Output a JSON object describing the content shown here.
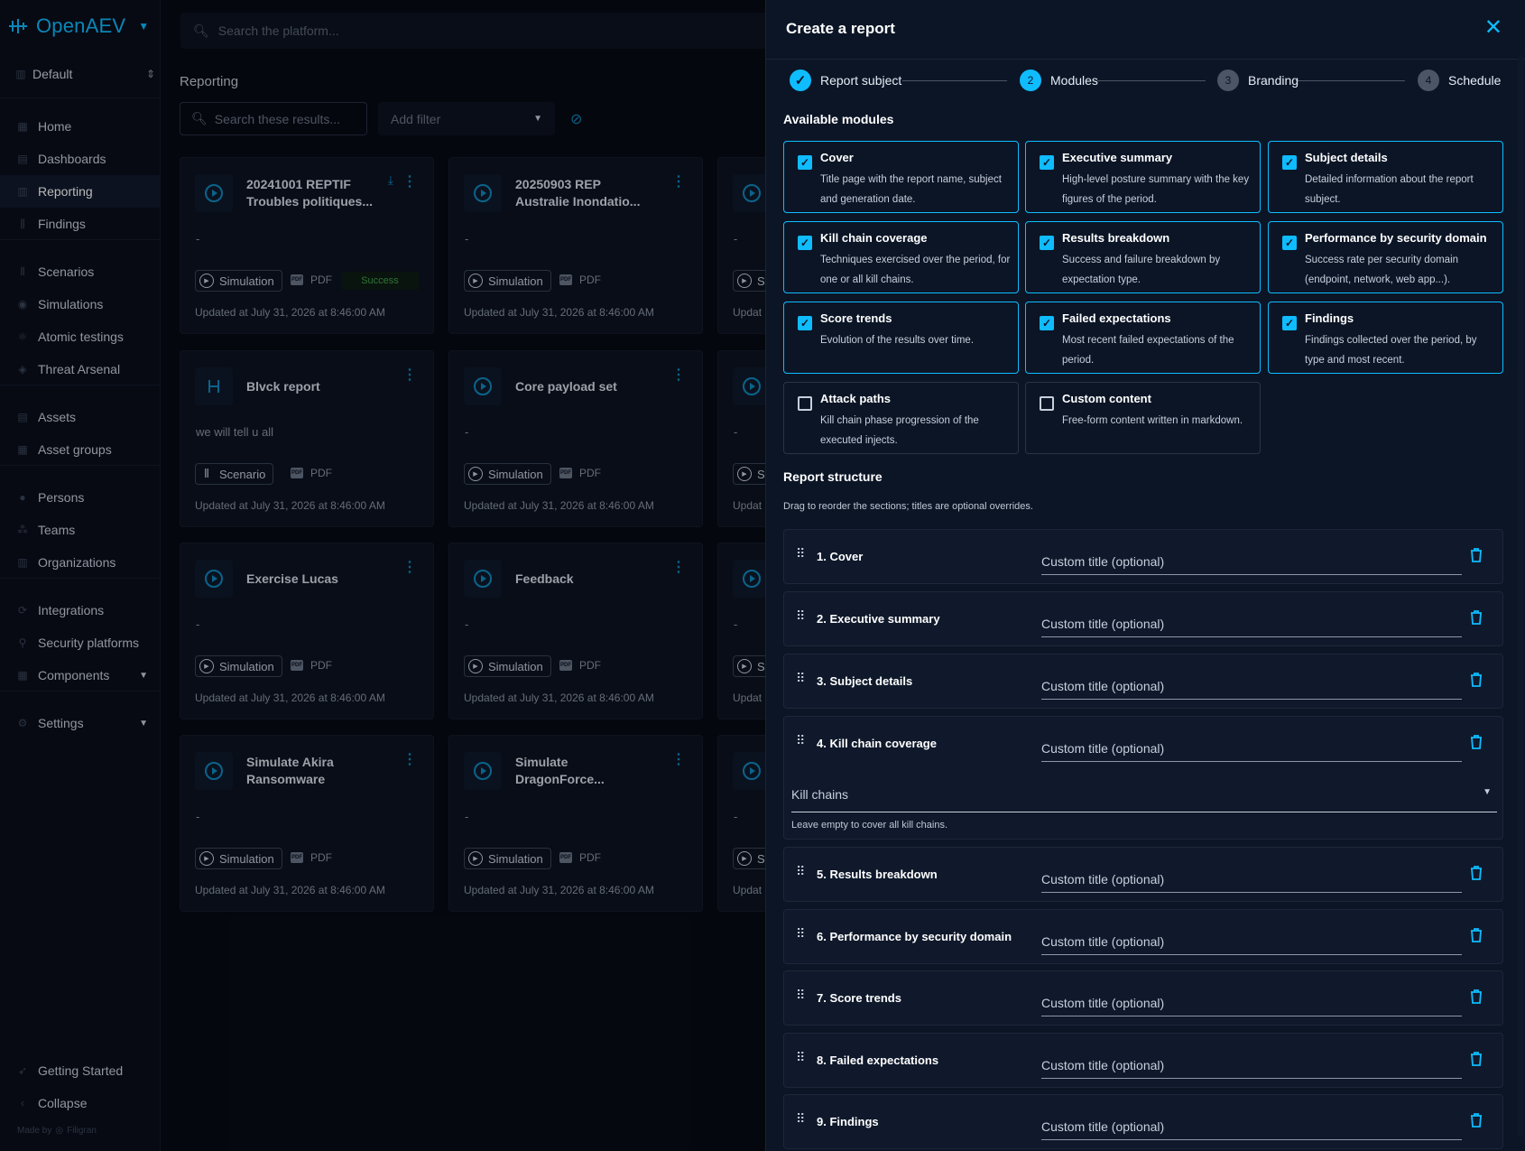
{
  "app": {
    "name": "OpenAEV",
    "workspace": "Default",
    "search_placeholder": "Search the platform...",
    "made_by": "Made by",
    "made_by_brand": "Filigran"
  },
  "sidebar": {
    "items": [
      {
        "label": "Home",
        "icon": "home-icon"
      },
      {
        "label": "Dashboards",
        "icon": "dashboard-icon"
      },
      {
        "label": "Reporting",
        "icon": "reporting-icon",
        "active": true
      },
      {
        "label": "Findings",
        "icon": "findings-icon"
      },
      {
        "label": "Scenarios",
        "icon": "scenario-icon"
      },
      {
        "label": "Simulations",
        "icon": "simulation-icon"
      },
      {
        "label": "Atomic testings",
        "icon": "atomic-icon"
      },
      {
        "label": "Threat Arsenal",
        "icon": "arsenal-icon"
      },
      {
        "label": "Assets",
        "icon": "assets-icon"
      },
      {
        "label": "Asset groups",
        "icon": "asset-groups-icon"
      },
      {
        "label": "Persons",
        "icon": "person-icon"
      },
      {
        "label": "Teams",
        "icon": "teams-icon"
      },
      {
        "label": "Organizations",
        "icon": "organization-icon"
      },
      {
        "label": "Integrations",
        "icon": "integrations-icon"
      },
      {
        "label": "Security platforms",
        "icon": "security-platform-icon"
      },
      {
        "label": "Components",
        "icon": "components-icon"
      },
      {
        "label": "Settings",
        "icon": "settings-icon"
      },
      {
        "label": "Getting Started",
        "icon": "rocket-icon"
      },
      {
        "label": "Collapse",
        "icon": "chevron-left-icon"
      }
    ]
  },
  "main": {
    "title": "Reporting",
    "search_placeholder": "Search these results...",
    "add_filter": "Add filter",
    "cards": [
      {
        "title": "20241001 REPTIF Troubles politiques...",
        "desc": "-",
        "type": "Simulation",
        "format": "PDF",
        "status": "Success",
        "updated": "Updated at July 31, 2026 at 8:46:00 AM"
      },
      {
        "title": "20250903 REP Australie Inondatio...",
        "desc": "-",
        "type": "Simulation",
        "format": "PDF",
        "updated": "Updated at July 31, 2026 at 8:46:00 AM"
      },
      {
        "title": "",
        "desc": "-",
        "type": "Si",
        "format": "",
        "updated": "Updat"
      },
      {
        "title": "Blvck report",
        "desc": "we will tell u all",
        "type": "Scenario",
        "format": "PDF",
        "updated": "Updated at July 31, 2026 at 8:46:00 AM"
      },
      {
        "title": "Core payload set",
        "desc": "-",
        "type": "Simulation",
        "format": "PDF",
        "updated": "Updated at July 31, 2026 at 8:46:00 AM"
      },
      {
        "title": "",
        "desc": "-",
        "type": "Si",
        "format": "",
        "updated": "Updat"
      },
      {
        "title": "Exercise Lucas",
        "desc": "-",
        "type": "Simulation",
        "format": "PDF",
        "updated": "Updated at July 31, 2026 at 8:46:00 AM"
      },
      {
        "title": "Feedback",
        "desc": "-",
        "type": "Simulation",
        "format": "PDF",
        "updated": "Updated at July 31, 2026 at 8:46:00 AM"
      },
      {
        "title": "",
        "desc": "-",
        "type": "Si",
        "format": "",
        "updated": "Updat"
      },
      {
        "title": "Simulate Akira Ransomware",
        "desc": "-",
        "type": "Simulation",
        "format": "PDF",
        "updated": "Updated at July 31, 2026 at 8:46:00 AM"
      },
      {
        "title": "Simulate DragonForce...",
        "desc": "-",
        "type": "Simulation",
        "format": "PDF",
        "updated": "Updated at July 31, 2026 at 8:46:00 AM"
      },
      {
        "title": "",
        "desc": "-",
        "type": "Si",
        "format": "",
        "updated": "Updat"
      }
    ]
  },
  "drawer": {
    "title": "Create a report",
    "steps": [
      {
        "number": "✓",
        "label": "Report subject",
        "state": "done"
      },
      {
        "number": "2",
        "label": "Modules",
        "state": "active"
      },
      {
        "number": "3",
        "label": "Branding",
        "state": "todo"
      },
      {
        "number": "4",
        "label": "Schedule",
        "state": "todo"
      }
    ],
    "available_modules_title": "Available modules",
    "modules": [
      {
        "title": "Cover",
        "desc": "Title page with the report name, subject and generation date.",
        "checked": true
      },
      {
        "title": "Executive summary",
        "desc": "High-level posture summary with the key figures of the period.",
        "checked": true
      },
      {
        "title": "Subject details",
        "desc": "Detailed information about the report subject.",
        "checked": true
      },
      {
        "title": "Kill chain coverage",
        "desc": "Techniques exercised over the period, for one or all kill chains.",
        "checked": true
      },
      {
        "title": "Results breakdown",
        "desc": "Success and failure breakdown by expectation type.",
        "checked": true
      },
      {
        "title": "Performance by security domain",
        "desc": "Success rate per security domain (endpoint, network, web app...).",
        "checked": true
      },
      {
        "title": "Score trends",
        "desc": "Evolution of the results over time.",
        "checked": true
      },
      {
        "title": "Failed expectations",
        "desc": "Most recent failed expectations of the period.",
        "checked": true
      },
      {
        "title": "Findings",
        "desc": "Findings collected over the period, by type and most recent.",
        "checked": true
      },
      {
        "title": "Attack paths",
        "desc": "Kill chain phase progression of the executed injects.",
        "checked": false
      },
      {
        "title": "Custom content",
        "desc": "Free-form content written in markdown.",
        "checked": false
      }
    ],
    "structure_title": "Report structure",
    "structure_subtitle": "Drag to reorder the sections; titles are optional overrides.",
    "custom_title_placeholder": "Custom title (optional)",
    "kill_chains_label": "Kill chains",
    "kill_chains_help": "Leave empty to cover all kill chains.",
    "sections": [
      {
        "label": "1. Cover"
      },
      {
        "label": "2. Executive summary"
      },
      {
        "label": "3. Subject details"
      },
      {
        "label": "4. Kill chain coverage",
        "kill_chains": true
      },
      {
        "label": "5. Results breakdown"
      },
      {
        "label": "6. Performance by security domain"
      },
      {
        "label": "7. Score trends"
      },
      {
        "label": "8. Failed expectations"
      },
      {
        "label": "9. Findings"
      }
    ]
  },
  "colors": {
    "accent": "#0fbcff",
    "background": "#070b14",
    "drawer": "#0b1526",
    "success": "#3fa04a"
  }
}
